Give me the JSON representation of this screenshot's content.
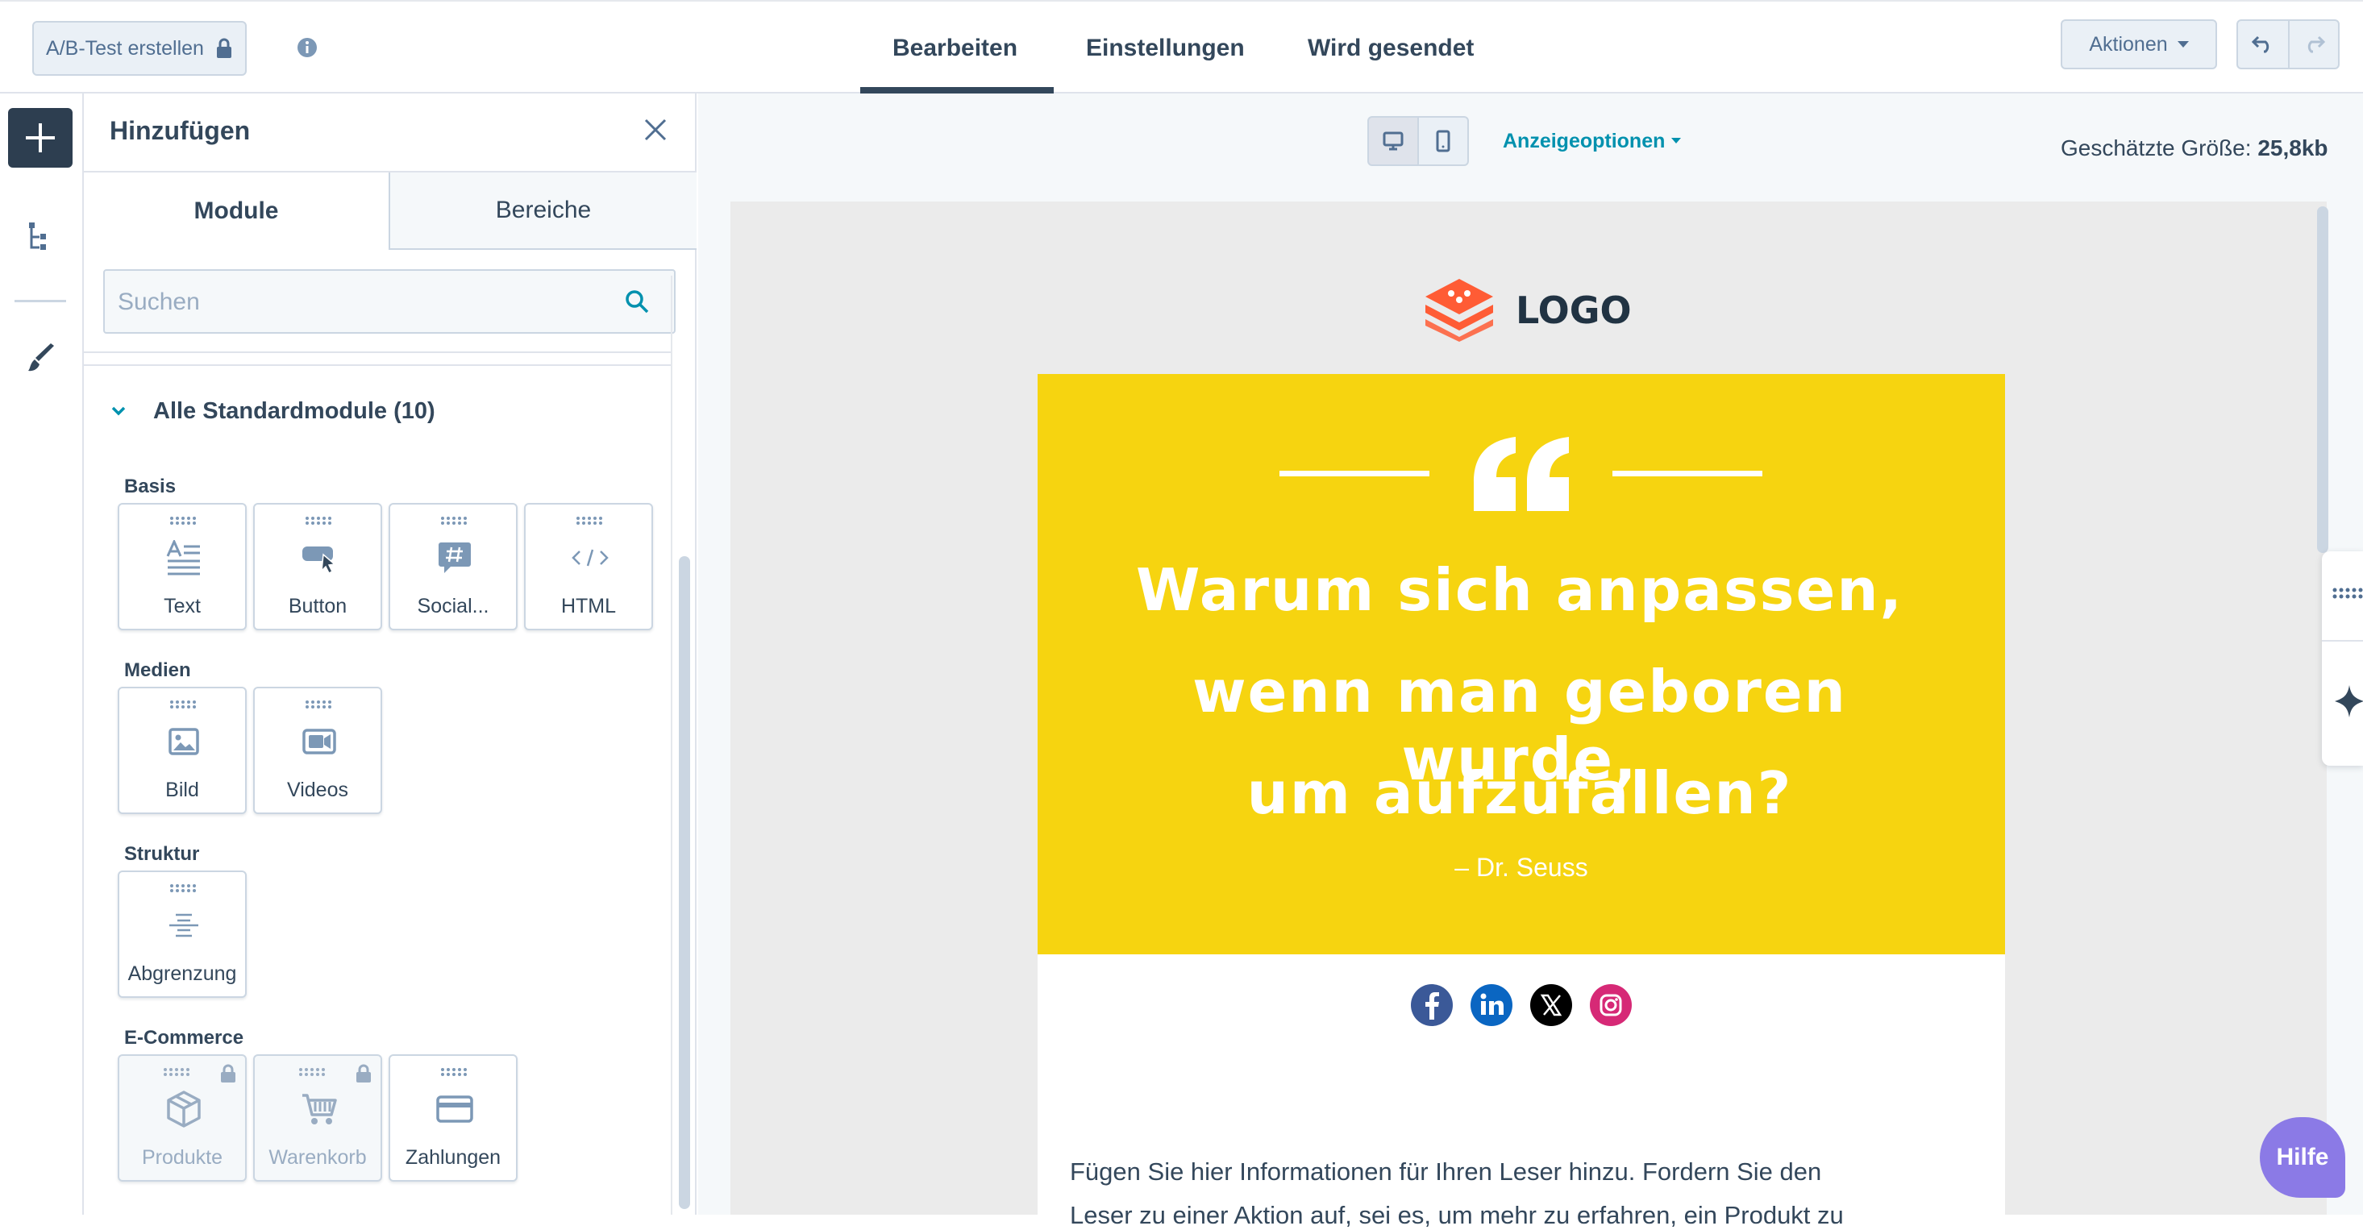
{
  "topbar": {
    "ab_test_label": "A/B-Test erstellen",
    "tabs": [
      {
        "label": "Bearbeiten",
        "active": true
      },
      {
        "label": "Einstellungen",
        "active": false
      },
      {
        "label": "Wird gesendet",
        "active": false
      }
    ],
    "actions_label": "Aktionen"
  },
  "left_rail": {
    "icons": [
      "plus-icon",
      "tree-icon",
      "brush-icon"
    ]
  },
  "panel": {
    "title": "Hinzufügen",
    "tabs": [
      {
        "label": "Module",
        "active": true
      },
      {
        "label": "Bereiche",
        "active": false
      }
    ],
    "search_placeholder": "Suchen",
    "section_title": "Alle Standardmodule (10)",
    "groups": [
      {
        "label": "Basis",
        "modules": [
          {
            "label": "Text",
            "icon": "text-icon",
            "locked": false
          },
          {
            "label": "Button",
            "icon": "button-icon",
            "locked": false
          },
          {
            "label": "Social...",
            "icon": "social-icon",
            "locked": false
          },
          {
            "label": "HTML",
            "icon": "html-icon",
            "locked": false
          }
        ]
      },
      {
        "label": "Medien",
        "modules": [
          {
            "label": "Bild",
            "icon": "image-icon",
            "locked": false
          },
          {
            "label": "Videos",
            "icon": "video-icon",
            "locked": false
          }
        ]
      },
      {
        "label": "Struktur",
        "modules": [
          {
            "label": "Abgrenzung",
            "icon": "divider-icon",
            "locked": false
          }
        ]
      },
      {
        "label": "E-Commerce",
        "modules": [
          {
            "label": "Produkte",
            "icon": "product-icon",
            "locked": true
          },
          {
            "label": "Warenkorb",
            "icon": "cart-icon",
            "locked": true
          },
          {
            "label": "Zahlungen",
            "icon": "payment-icon",
            "locked": false
          }
        ]
      }
    ]
  },
  "canvas": {
    "display_options_label": "Anzeigeoptionen",
    "size_label": "Geschätzte Größe:",
    "size_value": "25,8kb",
    "help_label": "Hilfe"
  },
  "email": {
    "logo_text": "LOGO",
    "quote_lines": [
      "Warum sich anpassen,",
      "wenn man geboren wurde,",
      "um aufzufallen?"
    ],
    "quote_author": "– Dr. Seuss",
    "social_icons": [
      "facebook-icon",
      "linkedin-icon",
      "x-icon",
      "instagram-icon"
    ],
    "body_text_line1": "Fügen Sie hier Informationen für Ihren Leser hinzu. Fordern Sie den",
    "body_text_line2": "Leser zu einer Aktion auf, sei es, um mehr zu erfahren, ein Produkt zu"
  },
  "colors": {
    "accent_teal": "#0091ae",
    "quote_yellow": "#f6d410",
    "logo_orange": "#ff5c35",
    "dark_navy": "#33475b",
    "help_purple": "#8b7ae6"
  }
}
